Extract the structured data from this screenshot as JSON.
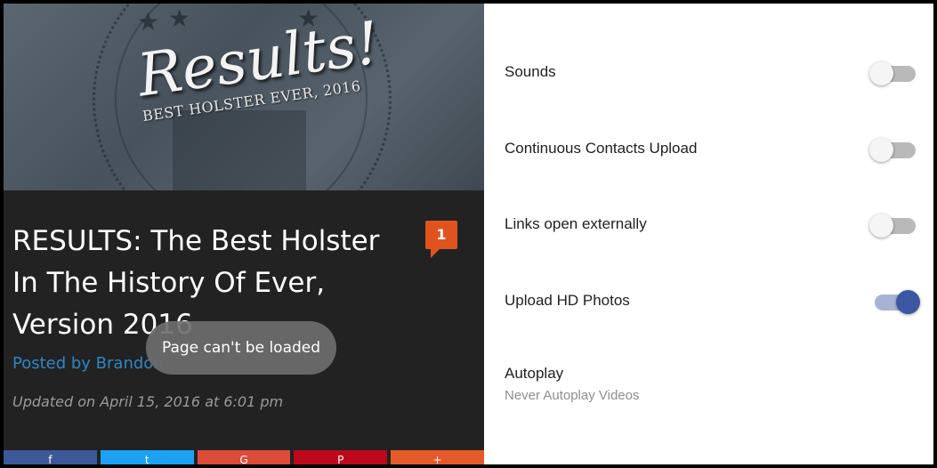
{
  "article": {
    "hero": {
      "title": "Results!",
      "subtitle": "BEST HOLSTER EVER, 2016"
    },
    "title": "RESULTS: The Best Holster In The History Of Ever, Version 2016",
    "comment_count": "1",
    "byline": "Posted by Brandon",
    "updated": "Updated on April 15, 2016 at 6:01 pm",
    "share_buttons": [
      {
        "icon": "facebook-icon",
        "glyph": "f",
        "color": "#3b5998"
      },
      {
        "icon": "twitter-icon",
        "glyph": "t",
        "color": "#1da1f2"
      },
      {
        "icon": "google-plus-icon",
        "glyph": "G",
        "color": "#dd4b39"
      },
      {
        "icon": "pinterest-icon",
        "glyph": "P",
        "color": "#bd081c"
      },
      {
        "icon": "share-icon",
        "glyph": "+",
        "color": "#e65a2a"
      }
    ]
  },
  "toast": {
    "message": "Page can't be loaded"
  },
  "settings": {
    "items": [
      {
        "label": "Sounds",
        "enabled": false
      },
      {
        "label": "Continuous Contacts Upload",
        "enabled": false
      },
      {
        "label": "Links open externally",
        "enabled": false
      },
      {
        "label": "Upload HD Photos",
        "enabled": true
      }
    ],
    "autoplay": {
      "title": "Autoplay",
      "value": "Never Autoplay Videos"
    }
  },
  "colors": {
    "accent": "#3b57a1",
    "comment_badge": "#e0531f",
    "byline_link": "#2f86c4"
  }
}
